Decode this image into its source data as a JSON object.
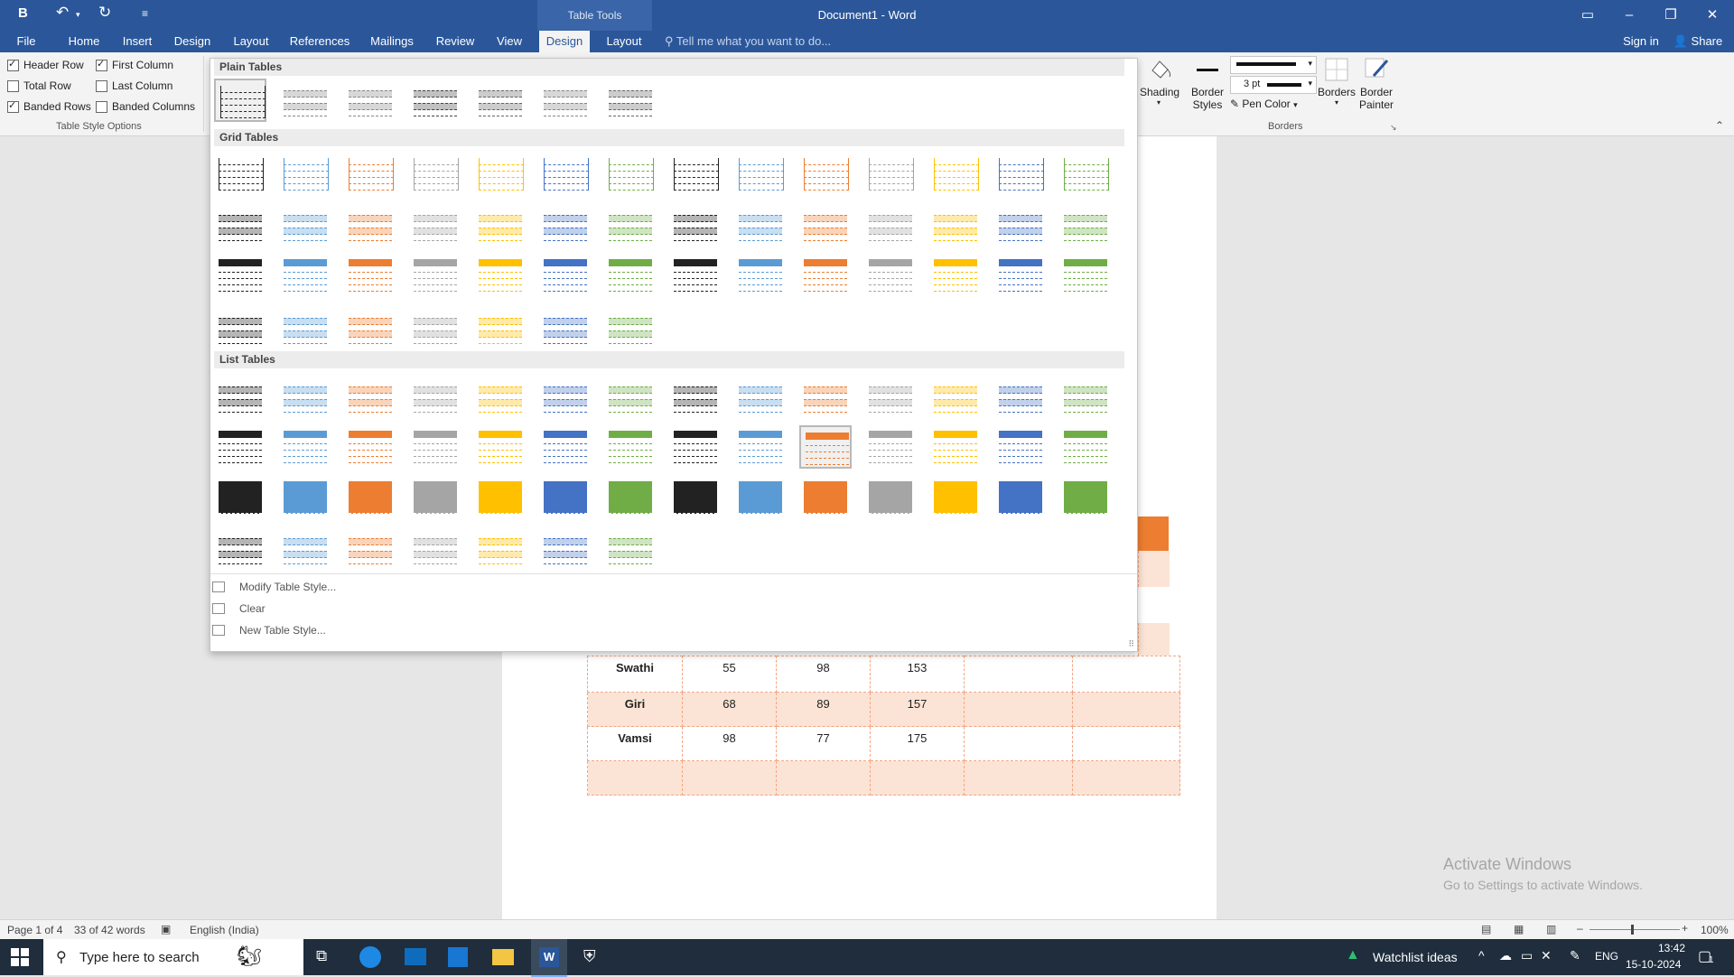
{
  "titlebar": {
    "qat": {
      "bold": "B",
      "undo": "↶",
      "redo": "↻",
      "customize": "≡"
    },
    "contextual_tab": "Table Tools",
    "document_title": "Document1 - Word"
  },
  "tabs": {
    "file": "File",
    "home": "Home",
    "insert": "Insert",
    "design": "Design",
    "layout": "Layout",
    "references": "References",
    "mailings": "Mailings",
    "review": "Review",
    "view": "View",
    "table_design": "Design",
    "table_layout": "Layout",
    "tell_me": "Tell me what you want to do...",
    "sign_in": "Sign in",
    "share": "Share"
  },
  "table_style_options": {
    "header_row": "Header Row",
    "first_column": "First Column",
    "total_row": "Total Row",
    "last_column": "Last Column",
    "banded_rows": "Banded Rows",
    "banded_columns": "Banded Columns",
    "group_label": "Table Style Options",
    "checked": {
      "header_row": true,
      "first_column": true,
      "total_row": false,
      "last_column": false,
      "banded_rows": true,
      "banded_columns": false
    }
  },
  "borders_group": {
    "shading": "Shading",
    "border_styles_1": "Border",
    "border_styles_2": "Styles",
    "pen_weight": "3 pt",
    "pen_color": "Pen Color",
    "borders": "Borders",
    "border_painter_1": "Border",
    "border_painter_2": "Painter",
    "group_label": "Borders"
  },
  "gallery": {
    "plain_tables": "Plain Tables",
    "grid_tables": "Grid Tables",
    "list_tables": "List Tables",
    "modify": "Modify Table Style...",
    "clear": "Clear",
    "new": "New Table Style...",
    "palette": [
      "#222222",
      "#5b9bd5",
      "#ed7d31",
      "#a5a5a5",
      "#ffc000",
      "#4472c4",
      "#70ad47"
    ]
  },
  "document_table": {
    "rows": [
      {
        "name": "Swathi",
        "a": "55",
        "b": "98",
        "c": "153"
      },
      {
        "name": "Giri",
        "a": "68",
        "b": "89",
        "c": "157"
      },
      {
        "name": "Vamsi",
        "a": "98",
        "b": "77",
        "c": "175"
      }
    ],
    "header_color": "#ed7d31",
    "band_color": "#fbe4d5"
  },
  "watermark": {
    "line1": "Activate Windows",
    "line2": "Go to Settings to activate Windows."
  },
  "statusbar": {
    "page": "Page 1 of 4",
    "words": "33 of 42 words",
    "language": "English (India)",
    "zoom": "100%"
  },
  "taskbar": {
    "search": "Type here to search",
    "watchlist": "Watchlist ideas",
    "lang": "ENG",
    "time": "13:42",
    "date": "15-10-2024",
    "notifications": "1"
  }
}
